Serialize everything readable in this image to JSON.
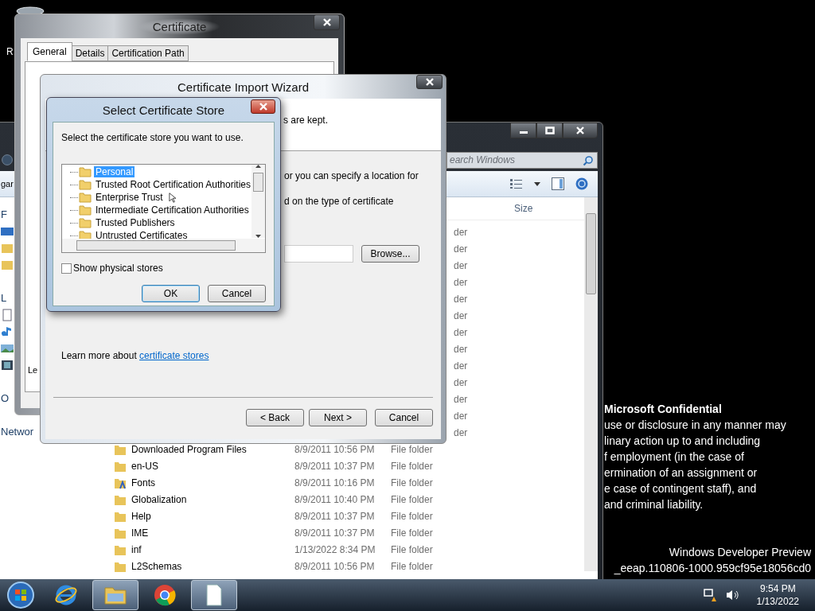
{
  "desktop": {
    "icon_label": "R",
    "notice_title": "Microsoft Confidential",
    "notice_lines": [
      "use or disclosure in any manner may",
      "linary action up to and including",
      "f employment (in the case of",
      "ermination of an assignment or",
      "e case of contingent staff), and",
      "and criminal liability."
    ],
    "build_lines": [
      "Windows Developer Preview",
      "_eeap.110806-1000.959cf95e18056cd0"
    ]
  },
  "explorer": {
    "toolbar_label": "gar",
    "search": {
      "placeholder": "earch Windows"
    },
    "columns": [
      {
        "label": "Size"
      }
    ],
    "nav": [
      {
        "kind": "header",
        "label": "F"
      },
      {
        "kind": "desktop"
      },
      {
        "kind": "downloads"
      },
      {
        "kind": "places"
      },
      {
        "kind": "gap"
      },
      {
        "kind": "header",
        "label": "L"
      },
      {
        "kind": "document"
      },
      {
        "kind": "music"
      },
      {
        "kind": "pictures"
      },
      {
        "kind": "video"
      },
      {
        "kind": "gap"
      },
      {
        "kind": "header",
        "label": "O"
      },
      {
        "kind": "gap"
      },
      {
        "kind": "header",
        "label": "Networ"
      }
    ],
    "rows": [
      {
        "kind": "partial",
        "type": "der"
      },
      {
        "kind": "partial",
        "type": "der"
      },
      {
        "kind": "partial",
        "type": "der"
      },
      {
        "kind": "partial",
        "type": "der"
      },
      {
        "kind": "partial",
        "type": "der"
      },
      {
        "kind": "partial",
        "type": "der"
      },
      {
        "kind": "partial",
        "type": "der"
      },
      {
        "kind": "partial",
        "type": "der"
      },
      {
        "kind": "partial",
        "type": "der"
      },
      {
        "kind": "partial",
        "type": "der"
      },
      {
        "kind": "partial",
        "type": "der"
      },
      {
        "kind": "partial",
        "type": "der"
      },
      {
        "kind": "partial",
        "type": "der"
      },
      {
        "kind": "folder",
        "name": "Downloaded Program Files",
        "date": "8/9/2011 10:56 PM",
        "type": "File folder"
      },
      {
        "kind": "folder",
        "name": "en-US",
        "date": "8/9/2011 10:37 PM",
        "type": "File folder"
      },
      {
        "kind": "fonts",
        "name": "Fonts",
        "date": "8/9/2011 10:16 PM",
        "type": "File folder"
      },
      {
        "kind": "folder",
        "name": "Globalization",
        "date": "8/9/2011 10:40 PM",
        "type": "File folder"
      },
      {
        "kind": "folder",
        "name": "Help",
        "date": "8/9/2011 10:37 PM",
        "type": "File folder"
      },
      {
        "kind": "folder",
        "name": "IME",
        "date": "8/9/2011 10:37 PM",
        "type": "File folder"
      },
      {
        "kind": "folder",
        "name": "inf",
        "date": "1/13/2022 8:34 PM",
        "type": "File folder"
      },
      {
        "kind": "folder",
        "name": "L2Schemas",
        "date": "8/9/2011 10:56 PM",
        "type": "File folder"
      }
    ]
  },
  "certificate": {
    "title": "Certificate",
    "tabs": [
      {
        "label": "General",
        "selected": true
      },
      {
        "label": "Details",
        "selected": false
      },
      {
        "label": "Certification Path",
        "selected": false
      }
    ],
    "fragment": "Le"
  },
  "wizard": {
    "title": "Certificate Import Wizard",
    "header_line": "s are kept.",
    "lines": [
      "or you can specify a location for",
      "d on the type of certificate"
    ],
    "browse": "Browse...",
    "learn_more": "Learn more about",
    "link": "certificate stores",
    "buttons": [
      "< Back",
      "Next >",
      "Cancel"
    ]
  },
  "store": {
    "title": "Select Certificate Store",
    "prompt": "Select the certificate store you want to use.",
    "stores": [
      {
        "label": "Personal",
        "selected": true
      },
      {
        "label": "Trusted Root Certification Authorities",
        "selected": false
      },
      {
        "label": "Enterprise Trust",
        "selected": false
      },
      {
        "label": "Intermediate Certification Authorities",
        "selected": false
      },
      {
        "label": "Trusted Publishers",
        "selected": false
      },
      {
        "label": "Untrusted Certificates",
        "selected": false
      }
    ],
    "show_physical": {
      "label": "Show physical stores",
      "checked": false
    },
    "buttons": [
      "OK",
      "Cancel"
    ]
  },
  "taskbar": {
    "apps": [
      {
        "kind": "browser-e",
        "selected": false
      },
      {
        "kind": "folder",
        "selected": true
      },
      {
        "kind": "chrome",
        "selected": false
      },
      {
        "kind": "document",
        "selected": true
      }
    ],
    "time": "9:54 PM",
    "date": "1/13/2022"
  }
}
